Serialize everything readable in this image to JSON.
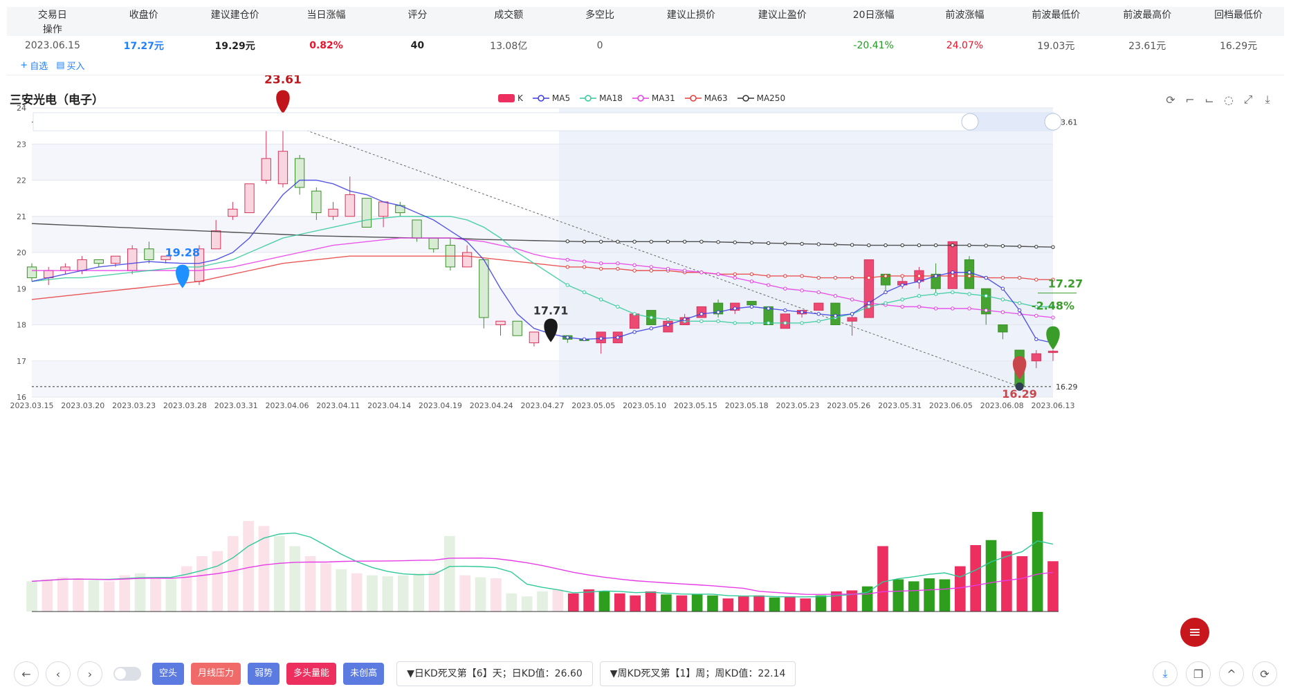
{
  "summary": {
    "headers": [
      "交易日",
      "收盘价",
      "建议建仓价",
      "当日涨幅",
      "评分",
      "成交额",
      "多空比",
      "建议止损价",
      "建议止盈价",
      "20日涨幅",
      "前波涨幅",
      "前波最低价",
      "前波最高价",
      "回档最低价",
      "操作"
    ],
    "row": [
      "2023.06.15",
      "17.27元",
      "19.29元",
      "0.82%",
      "40",
      "13.08亿",
      "0",
      "",
      "",
      "-20.41%",
      "24.07%",
      "19.03元",
      "23.61元",
      "16.29元"
    ],
    "row_colors": [
      "#555",
      "#1e80ff",
      "#222",
      "#e8132a",
      "#222",
      "#555",
      "#555",
      "#555",
      "#555",
      "#1f9d1f",
      "#e8132a",
      "#555",
      "#555",
      "#555"
    ],
    "ops": [
      {
        "icon": "plus-icon",
        "label": "自选"
      },
      {
        "icon": "buy-icon",
        "label": "买入"
      }
    ]
  },
  "chart": {
    "title": "三安光电（电子）",
    "legend": [
      {
        "name": "K",
        "color": "#ec2f5f"
      },
      {
        "name": "MA5",
        "color": "#3a3ae0"
      },
      {
        "name": "MA18",
        "color": "#33c99a"
      },
      {
        "name": "MA31",
        "color": "#e63ce6"
      },
      {
        "name": "MA63",
        "color": "#e63a3a"
      },
      {
        "name": "MA250",
        "color": "#333333"
      }
    ],
    "annotations": {
      "high_label": "23.61",
      "low_label": "16.29",
      "buy_label": "19.28",
      "mid_label": "17.71",
      "last_price": "17.27",
      "last_pct": "-2.48%",
      "ref_high": "23.61",
      "ref_low": "16.29"
    }
  },
  "chart_data": {
    "type": "candlestick",
    "ylim": [
      16,
      24
    ],
    "y_ticks": [
      16,
      17,
      18,
      19,
      20,
      21,
      22,
      23,
      24
    ],
    "x_tick_labels": [
      "2023.03.15",
      "2023.03.20",
      "2023.03.23",
      "2023.03.28",
      "2023.03.31",
      "2023.04.06",
      "2023.04.11",
      "2023.04.14",
      "2023.04.19",
      "2023.04.24",
      "2023.04.27",
      "2023.05.05",
      "2023.05.10",
      "2023.05.15",
      "2023.05.18",
      "2023.05.23",
      "2023.05.26",
      "2023.05.31",
      "2023.06.05",
      "2023.06.08",
      "2023.06.13"
    ],
    "candles": [
      [
        19.6,
        19.3,
        19.7,
        19.2
      ],
      [
        19.3,
        19.5,
        19.6,
        19.1
      ],
      [
        19.5,
        19.6,
        19.7,
        19.4
      ],
      [
        19.5,
        19.8,
        19.9,
        19.4
      ],
      [
        19.8,
        19.7,
        19.8,
        19.6
      ],
      [
        19.7,
        19.9,
        19.9,
        19.6
      ],
      [
        19.5,
        20.1,
        20.2,
        19.4
      ],
      [
        20.1,
        19.8,
        20.3,
        19.7
      ],
      [
        19.8,
        19.9,
        19.9,
        19.7
      ],
      [
        19.5,
        19.3,
        19.6,
        19.3
      ],
      [
        19.2,
        20.1,
        20.2,
        19.1
      ],
      [
        20.1,
        20.6,
        20.9,
        20.1
      ],
      [
        21.0,
        21.2,
        21.4,
        20.9
      ],
      [
        21.1,
        21.9,
        21.9,
        21.1
      ],
      [
        22.0,
        22.6,
        23.4,
        21.9
      ],
      [
        21.9,
        22.8,
        23.61,
        21.8
      ],
      [
        22.6,
        21.8,
        22.7,
        21.6
      ],
      [
        21.7,
        21.1,
        21.8,
        20.9
      ],
      [
        21.0,
        21.2,
        21.4,
        20.9
      ],
      [
        21.0,
        21.6,
        22.1,
        21.0
      ],
      [
        21.5,
        20.7,
        21.5,
        20.7
      ],
      [
        21.0,
        21.4,
        21.4,
        20.7
      ],
      [
        21.3,
        21.1,
        21.4,
        21.0
      ],
      [
        20.9,
        20.4,
        20.9,
        20.3
      ],
      [
        20.4,
        20.1,
        20.4,
        20.0
      ],
      [
        20.2,
        19.6,
        20.4,
        19.5
      ],
      [
        19.6,
        20.0,
        20.2,
        19.6
      ],
      [
        19.8,
        18.2,
        19.8,
        17.9
      ],
      [
        18.0,
        18.1,
        18.1,
        17.7
      ],
      [
        18.1,
        17.7,
        18.1,
        17.7
      ],
      [
        17.5,
        17.8,
        17.8,
        17.4
      ],
      [
        17.8,
        17.75,
        17.8,
        17.7
      ],
      [
        17.7,
        17.6,
        17.7,
        17.5
      ],
      [
        17.6,
        17.58,
        17.6,
        17.55
      ],
      [
        17.5,
        17.8,
        17.8,
        17.2
      ],
      [
        17.5,
        17.8,
        17.8,
        17.5
      ],
      [
        17.9,
        18.3,
        18.3,
        17.9
      ],
      [
        18.4,
        18.0,
        18.4,
        18.0
      ],
      [
        17.8,
        18.1,
        18.2,
        17.8
      ],
      [
        18.0,
        18.2,
        18.3,
        18.0
      ],
      [
        18.2,
        18.5,
        18.5,
        18.2
      ],
      [
        18.6,
        18.3,
        18.7,
        18.2
      ],
      [
        18.4,
        18.6,
        18.6,
        18.3
      ],
      [
        18.65,
        18.55,
        18.65,
        18.5
      ],
      [
        18.5,
        18.0,
        18.5,
        18.0
      ],
      [
        17.9,
        18.3,
        18.3,
        17.9
      ],
      [
        18.3,
        18.4,
        18.4,
        18.2
      ],
      [
        18.4,
        18.6,
        18.6,
        18.4
      ],
      [
        18.6,
        18.0,
        18.6,
        18.0
      ],
      [
        18.1,
        18.2,
        18.3,
        17.7
      ],
      [
        18.2,
        19.8,
        19.8,
        18.2
      ],
      [
        19.4,
        19.1,
        19.4,
        18.9
      ],
      [
        19.1,
        19.2,
        19.3,
        19.0
      ],
      [
        19.2,
        19.5,
        19.6,
        19.0
      ],
      [
        19.4,
        19.0,
        19.7,
        18.9
      ],
      [
        19.0,
        20.3,
        20.3,
        19.0
      ],
      [
        19.8,
        19.0,
        19.9,
        19.0
      ],
      [
        19.0,
        18.3,
        19.0,
        18.0
      ],
      [
        18.0,
        17.8,
        18.0,
        17.6
      ],
      [
        17.3,
        16.3,
        17.3,
        16.29
      ],
      [
        17.0,
        17.2,
        17.3,
        16.8
      ],
      [
        17.25,
        17.27,
        17.3,
        17.0
      ]
    ],
    "ma5": [
      19.2,
      19.3,
      19.4,
      19.5,
      19.6,
      19.65,
      19.7,
      19.75,
      19.72,
      19.7,
      19.7,
      19.8,
      20.0,
      20.4,
      21.0,
      21.6,
      22.0,
      22.0,
      21.9,
      21.7,
      21.6,
      21.4,
      21.3,
      21.1,
      20.9,
      20.6,
      20.3,
      19.8,
      19.0,
      18.3,
      17.9,
      17.75,
      17.65,
      17.6,
      17.62,
      17.65,
      17.8,
      17.9,
      18.0,
      18.15,
      18.3,
      18.35,
      18.45,
      18.5,
      18.45,
      18.4,
      18.35,
      18.3,
      18.25,
      18.3,
      18.6,
      18.9,
      19.1,
      19.2,
      19.35,
      19.45,
      19.45,
      19.3,
      19.0,
      18.4,
      17.6,
      17.5
    ],
    "ma18": [
      19.2,
      19.25,
      19.3,
      19.3,
      19.35,
      19.4,
      19.45,
      19.5,
      19.55,
      19.6,
      19.6,
      19.7,
      19.8,
      20.0,
      20.2,
      20.4,
      20.5,
      20.6,
      20.7,
      20.8,
      20.9,
      20.95,
      21.0,
      21.0,
      21.0,
      21.0,
      20.9,
      20.7,
      20.4,
      20.0,
      19.7,
      19.4,
      19.1,
      18.9,
      18.7,
      18.5,
      18.3,
      18.2,
      18.15,
      18.1,
      18.1,
      18.1,
      18.05,
      18.05,
      18.05,
      18.05,
      18.05,
      18.1,
      18.2,
      18.3,
      18.5,
      18.6,
      18.7,
      18.8,
      18.85,
      18.9,
      18.85,
      18.8,
      18.7,
      18.6,
      18.5,
      18.5
    ],
    "ma31": [
      19.5,
      19.5,
      19.5,
      19.5,
      19.5,
      19.5,
      19.5,
      19.5,
      19.5,
      19.5,
      19.5,
      19.55,
      19.6,
      19.7,
      19.8,
      19.9,
      20.0,
      20.1,
      20.2,
      20.25,
      20.3,
      20.35,
      20.4,
      20.4,
      20.4,
      20.4,
      20.35,
      20.3,
      20.2,
      20.1,
      19.95,
      19.85,
      19.8,
      19.75,
      19.7,
      19.7,
      19.65,
      19.6,
      19.55,
      19.5,
      19.45,
      19.4,
      19.3,
      19.2,
      19.1,
      19.0,
      18.95,
      18.9,
      18.8,
      18.7,
      18.6,
      18.55,
      18.5,
      18.5,
      18.45,
      18.45,
      18.45,
      18.4,
      18.35,
      18.3,
      18.25,
      18.2
    ],
    "ma63": [
      18.7,
      18.75,
      18.8,
      18.85,
      18.9,
      18.95,
      19.0,
      19.05,
      19.1,
      19.15,
      19.2,
      19.3,
      19.4,
      19.5,
      19.6,
      19.7,
      19.75,
      19.8,
      19.85,
      19.9,
      19.9,
      19.9,
      19.9,
      19.9,
      19.9,
      19.9,
      19.9,
      19.85,
      19.8,
      19.75,
      19.7,
      19.65,
      19.6,
      19.6,
      19.55,
      19.55,
      19.5,
      19.5,
      19.5,
      19.45,
      19.45,
      19.4,
      19.4,
      19.4,
      19.35,
      19.35,
      19.35,
      19.3,
      19.3,
      19.3,
      19.3,
      19.35,
      19.35,
      19.35,
      19.35,
      19.35,
      19.35,
      19.3,
      19.3,
      19.3,
      19.25,
      19.25
    ],
    "ma250": [
      20.8,
      20.78,
      20.76,
      20.74,
      20.72,
      20.7,
      20.68,
      20.66,
      20.64,
      20.62,
      20.6,
      20.58,
      20.56,
      20.54,
      20.52,
      20.5,
      20.48,
      20.46,
      20.45,
      20.44,
      20.43,
      20.42,
      20.41,
      20.4,
      20.4,
      20.4,
      20.38,
      20.36,
      20.35,
      20.34,
      20.33,
      20.32,
      20.31,
      20.3,
      20.3,
      20.3,
      20.3,
      20.3,
      20.3,
      20.3,
      20.3,
      20.29,
      20.28,
      20.27,
      20.26,
      20.25,
      20.24,
      20.23,
      20.22,
      20.21,
      20.2,
      20.2,
      20.2,
      20.2,
      20.2,
      20.2,
      20.2,
      20.19,
      20.18,
      20.17,
      20.16,
      20.15
    ],
    "volume": [
      3.0,
      3.2,
      3.4,
      3.3,
      3.1,
      3.0,
      3.6,
      3.8,
      3.4,
      3.2,
      4.5,
      5.5,
      6.0,
      7.5,
      9.0,
      8.5,
      7.5,
      6.5,
      5.5,
      4.8,
      4.2,
      3.8,
      3.6,
      3.5,
      3.6,
      3.8,
      4.0,
      7.5,
      3.6,
      3.4,
      3.3,
      1.8,
      1.5,
      2.0,
      2.2,
      1.8,
      2.2,
      2.0,
      1.8,
      1.6,
      2.0,
      1.7,
      1.6,
      1.7,
      1.6,
      1.3,
      1.5,
      1.6,
      1.4,
      1.5,
      1.3,
      1.6,
      2.0,
      2.1,
      2.5,
      6.5,
      3.2,
      3.0,
      3.3,
      3.2,
      4.5,
      6.6,
      7.1,
      6.0,
      5.5,
      9.9,
      5.0
    ],
    "volume_up": [
      false,
      true,
      true,
      true,
      false,
      true,
      true,
      false,
      true,
      false,
      true,
      true,
      true,
      true,
      true,
      true,
      false,
      false,
      true,
      true,
      false,
      true,
      false,
      false,
      false,
      false,
      true,
      false,
      true,
      false,
      true,
      false,
      false,
      false,
      true,
      true,
      true,
      false,
      true,
      true,
      true,
      false,
      true,
      false,
      false,
      true,
      true,
      true,
      false,
      true,
      true,
      false,
      true,
      true,
      false,
      true,
      false,
      false,
      false,
      false,
      true,
      true,
      false,
      true,
      true,
      false,
      true
    ]
  },
  "bottom": {
    "tags": [
      {
        "label": "空头",
        "color": "#5b7be0"
      },
      {
        "label": "月线压力",
        "color": "#f06a6a"
      },
      {
        "label": "弱势",
        "color": "#5b7be0"
      },
      {
        "label": "多头量能",
        "color": "#ec2f5f"
      },
      {
        "label": "未创高",
        "color": "#5b7be0"
      }
    ],
    "info1": "▼日KD死叉第【6】天；日KD值：26.60",
    "info2": "▼周KD死叉第【1】周；周KD值：22.14"
  }
}
